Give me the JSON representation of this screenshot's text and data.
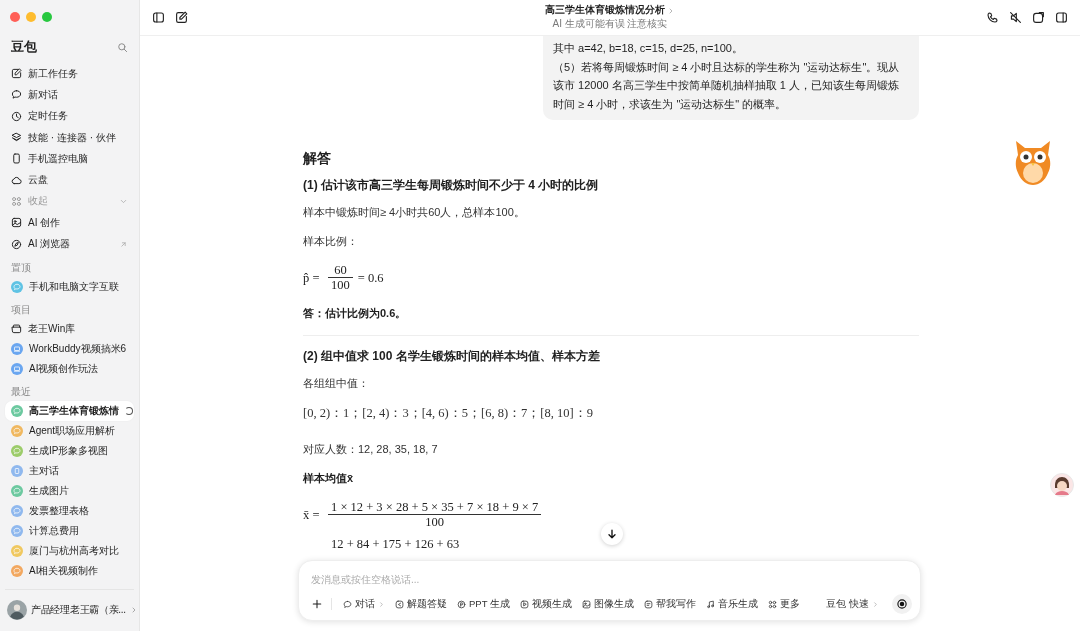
{
  "sidebar": {
    "title": "豆包",
    "nav": [
      {
        "label": "新工作任务",
        "kind": "edit"
      },
      {
        "label": "新对话",
        "kind": "chat"
      },
      {
        "label": "定时任务",
        "kind": "clock"
      },
      {
        "label": "技能 · 连接器 · 伙伴",
        "kind": "layers"
      },
      {
        "label": "手机遥控电脑",
        "kind": "phone"
      },
      {
        "label": "云盘",
        "kind": "cloud"
      },
      {
        "label": "收起",
        "kind": "grid",
        "muted": true,
        "collapsible": true
      },
      {
        "label": "AI 创作",
        "kind": "image"
      },
      {
        "label": "AI 浏览器",
        "kind": "compass",
        "external": true
      }
    ],
    "sections": [
      {
        "heading": "置顶",
        "items": [
          {
            "label": "手机和电脑文字互联",
            "kind": "chat",
            "color": "#5fc3e4",
            "selected": false
          }
        ]
      },
      {
        "heading": "项目",
        "items": [
          {
            "label": "老王Win库",
            "kind": "folder",
            "selected": false
          },
          {
            "label": "WorkBuddy视频搞米6",
            "kind": "laptop",
            "color": "#6aa6f0",
            "selected": false
          },
          {
            "label": "AI视频创作玩法",
            "kind": "laptop",
            "color": "#6aa6f0",
            "selected": false
          }
        ]
      },
      {
        "heading": "最近",
        "items": [
          {
            "label": "高三学生体育锻炼情",
            "kind": "chat",
            "color": "#6cc9a0",
            "selected": true,
            "loading": true
          },
          {
            "label": "Agent职场应用解析",
            "kind": "chat",
            "color": "#f0b860",
            "selected": false
          },
          {
            "label": "生成IP形象多视图",
            "kind": "chat",
            "color": "#9ccc6a",
            "selected": false
          },
          {
            "label": "主对话",
            "kind": "doc",
            "color": "#8fb8ee",
            "selected": false
          },
          {
            "label": "生成图片",
            "kind": "chat",
            "color": "#6cc9a0",
            "selected": false
          },
          {
            "label": "发票整理表格",
            "kind": "chat",
            "color": "#8fb8ee",
            "selected": false
          },
          {
            "label": "计算总费用",
            "kind": "chat",
            "color": "#8fb8ee",
            "selected": false
          },
          {
            "label": "厦门与杭州高考对比",
            "kind": "chat",
            "color": "#f0c860",
            "selected": false
          },
          {
            "label": "AI相关视频制作",
            "kind": "chat",
            "color": "#f2a860",
            "selected": false
          }
        ]
      }
    ],
    "user": {
      "name": "产品经理老王霸（亲..."
    }
  },
  "header": {
    "title": "高三学生体育锻炼情况分析",
    "subtitle": "AI 生成可能有误 注意核实"
  },
  "question": [
    "其中 a=42, b=18, c=15, d=25, n=100。",
    "（5）若将每周锻炼时间 ≥ 4 小时且达标的学生称为 \"运动达标生\"。现从该市 12000 名高三学生中按简单随机抽样抽取 1 人，已知该生每周锻炼时间 ≥ 4 小时，求该生为 \"运动达标生\" 的概率。"
  ],
  "answer": [
    {
      "kind": "h2",
      "text": "解答"
    },
    {
      "kind": "h3",
      "text": "(1) 估计该市高三学生每周锻炼时间不少于 4 小时的比例"
    },
    {
      "kind": "p",
      "text": "样本中锻炼时间≥ 4小时共60人，总样本100。"
    },
    {
      "kind": "p",
      "text": "样本比例："
    },
    {
      "kind": "frac",
      "lhs": "p̂ =",
      "num": "60",
      "den": "100",
      "rhs": "= 0.6"
    },
    {
      "kind": "strong",
      "text": "答：估计比例为0.6。"
    },
    {
      "kind": "hr"
    },
    {
      "kind": "h3",
      "text": "(2) 组中值求 100 名学生锻炼时间的样本均值、样本方差"
    },
    {
      "kind": "p",
      "text": "各组组中值："
    },
    {
      "kind": "math",
      "text": "[0, 2)：1；[2, 4)：3；[4, 6)：5；[6, 8)：7；[8, 10]：9"
    },
    {
      "kind": "p",
      "text": "对应人数：12, 28, 35, 18, 7"
    },
    {
      "kind": "strong",
      "text": "样本均值x̄"
    },
    {
      "kind": "frac",
      "lhs": "x̄ =",
      "num": "1 × 12 + 3 × 28 + 5 × 35 + 7 × 18 + 9 × 7",
      "den": "100"
    },
    {
      "kind": "frac",
      "num": "12 + 84 + 175 + 126 + 63"
    }
  ],
  "composer": {
    "placeholder": "发消息或按住空格说话...",
    "tools": [
      {
        "label": "对话",
        "kind": "chat",
        "trail": true
      },
      {
        "label": "解题答疑",
        "kind": "solve"
      },
      {
        "label": "PPT 生成",
        "kind": "ppt"
      },
      {
        "label": "视频生成",
        "kind": "video"
      },
      {
        "label": "图像生成",
        "kind": "image"
      },
      {
        "label": "帮我写作",
        "kind": "write"
      },
      {
        "label": "音乐生成",
        "kind": "music"
      },
      {
        "label": "更多",
        "kind": "grid"
      }
    ],
    "model": "豆包 快速"
  }
}
